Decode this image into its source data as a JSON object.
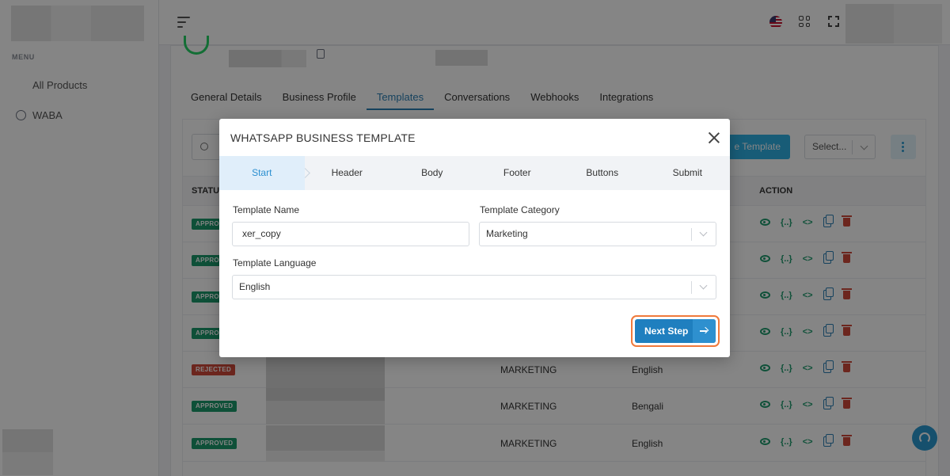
{
  "sidebar": {
    "menu_label": "MENU",
    "items": [
      {
        "label": "All Products",
        "icon": "grid-icon"
      },
      {
        "label": "WABA",
        "icon": "whatsapp-icon"
      }
    ]
  },
  "topbar": {
    "icons": [
      "menu-icon",
      "us-flag-icon",
      "apps-icon",
      "fullscreen-icon"
    ]
  },
  "page": {
    "tabs": [
      "General Details",
      "Business Profile",
      "Templates",
      "Conversations",
      "Webhooks",
      "Integrations"
    ],
    "active_tab": "Templates",
    "create_button_label": "e Template",
    "select_placeholder": "Select...",
    "table_headers": {
      "status": "STATU",
      "action": "ACTION"
    },
    "rows": [
      {
        "status": "APPRO",
        "type": "approved",
        "category": "",
        "language": ""
      },
      {
        "status": "APPRO",
        "type": "approved",
        "category": "",
        "language": ""
      },
      {
        "status": "APPRO",
        "type": "approved",
        "category": "",
        "language": ""
      },
      {
        "status": "APPRO",
        "type": "approved",
        "category": "",
        "language": ""
      },
      {
        "status": "REJECTED",
        "type": "rejected",
        "category": "MARKETING",
        "language": "English"
      },
      {
        "status": "APPROVED",
        "type": "approved",
        "category": "MARKETING",
        "language": "Bengali"
      },
      {
        "status": "APPROVED",
        "type": "approved",
        "category": "MARKETING",
        "language": "English"
      }
    ]
  },
  "modal": {
    "title": "WHATSAPP BUSINESS TEMPLATE",
    "steps": [
      "Start",
      "Header",
      "Body",
      "Footer",
      "Buttons",
      "Submit"
    ],
    "active_step": "Start",
    "template_name_label": "Template Name",
    "template_name_value": "xer_copy",
    "template_category_label": "Template Category",
    "template_category_value": "Marketing",
    "template_language_label": "Template Language",
    "template_language_value": "English",
    "next_button_label": "Next Step"
  },
  "colors": {
    "accent": "#1f7fbf",
    "approved": "#1c9a6c",
    "rejected": "#d04a3a",
    "highlight_ring": "#f07a3c"
  }
}
